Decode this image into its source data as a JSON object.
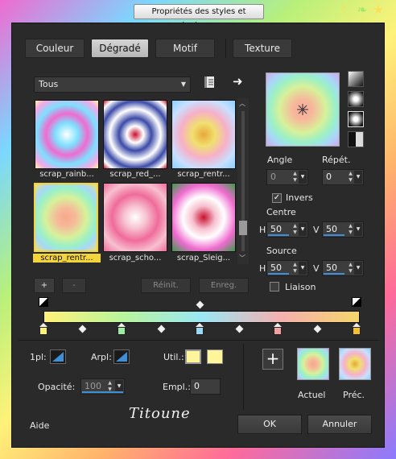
{
  "window": {
    "title": "Propriétés des styles et textures"
  },
  "tabs": [
    {
      "label": "Couleur",
      "active": false
    },
    {
      "label": "Dégradé",
      "active": true
    },
    {
      "label": "Motif",
      "active": false
    },
    {
      "label": "Texture",
      "active": false
    }
  ],
  "gallery": {
    "category": "Tous",
    "items": [
      {
        "label": "scrap_rainb...",
        "selected": false
      },
      {
        "label": "scrap_red_...",
        "selected": false
      },
      {
        "label": "scrap_rentr...",
        "selected": false
      },
      {
        "label": "scrap_rentr...",
        "selected": true
      },
      {
        "label": "scrap_scho...",
        "selected": false
      },
      {
        "label": "scrap_Sleig...",
        "selected": false
      }
    ],
    "buttons": {
      "add": "+",
      "remove": "-",
      "reset": "Réinit.",
      "save": "Enreg."
    }
  },
  "params": {
    "angle_label": "Angle",
    "angle_value": "0",
    "repeat_label": "Répét.",
    "repeat_value": "0",
    "invert_label": "Invers",
    "invert_checked": true,
    "centre_label": "Centre",
    "centre_h": "50",
    "centre_v": "50",
    "source_label": "Source",
    "source_h": "50",
    "source_v": "50",
    "h_label": "H",
    "v_label": "V",
    "link_label": "Liaison",
    "link_checked": false
  },
  "stops": {
    "first_label": "1pl:",
    "arpl_label": "Arpl:",
    "util_label": "Util.:",
    "opacity_label": "Opacité:",
    "opacity_value": "100",
    "empl_label": "Empl.:",
    "empl_value": "0"
  },
  "previews": {
    "add_symbol": "+",
    "current_label": "Actuel",
    "previous_label": "Préc."
  },
  "footer": {
    "help": "Aide",
    "ok": "OK",
    "cancel": "Annuler",
    "signature": "Titoune"
  }
}
